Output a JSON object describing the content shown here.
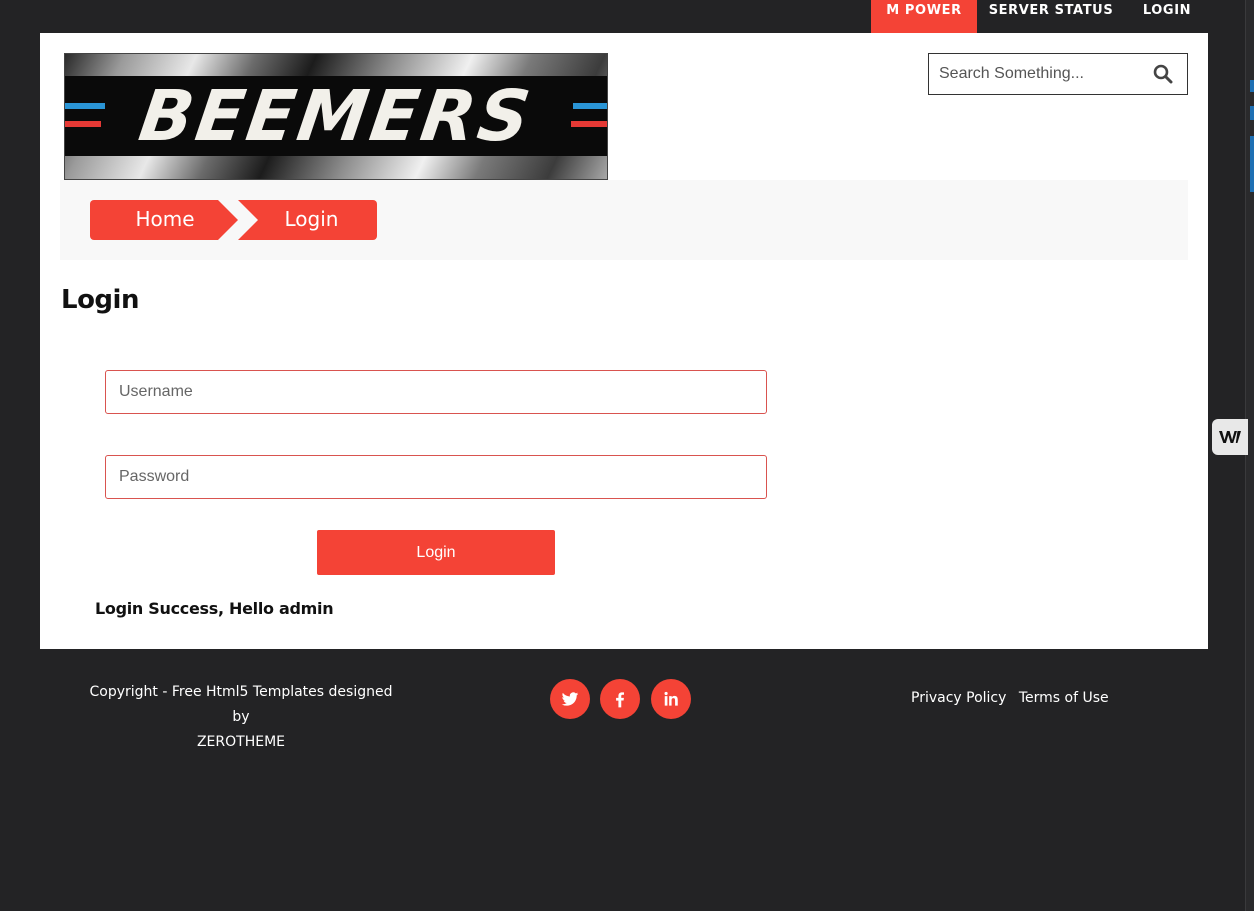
{
  "topnav": {
    "items": [
      {
        "label": "M POWER",
        "active": true
      },
      {
        "label": "SERVER STATUS",
        "active": false
      },
      {
        "label": "LOGIN",
        "active": false
      }
    ]
  },
  "header": {
    "logo_text": "BEEMERS",
    "search": {
      "placeholder": "Search Something...",
      "value": ""
    }
  },
  "breadcrumb": [
    {
      "label": "Home"
    },
    {
      "label": "Login"
    }
  ],
  "main": {
    "title": "Login",
    "form": {
      "username_placeholder": "Username",
      "password_placeholder": "Password",
      "submit_label": "Login"
    },
    "status_message": "Login Success, Hello admin"
  },
  "footer": {
    "copyright_prefix": "Copyright - ",
    "template_link": "Free Html5 Templates",
    "designed_by": " designed by",
    "designer": "ZEROTHEME",
    "social": [
      "twitter-icon",
      "facebook-icon",
      "linkedin-icon"
    ],
    "links": [
      "Privacy Policy",
      "Terms of Use"
    ]
  },
  "colors": {
    "accent": "#f44336",
    "background": "#232325",
    "content": "#ffffff",
    "crumbbar": "#f8f8f8"
  }
}
